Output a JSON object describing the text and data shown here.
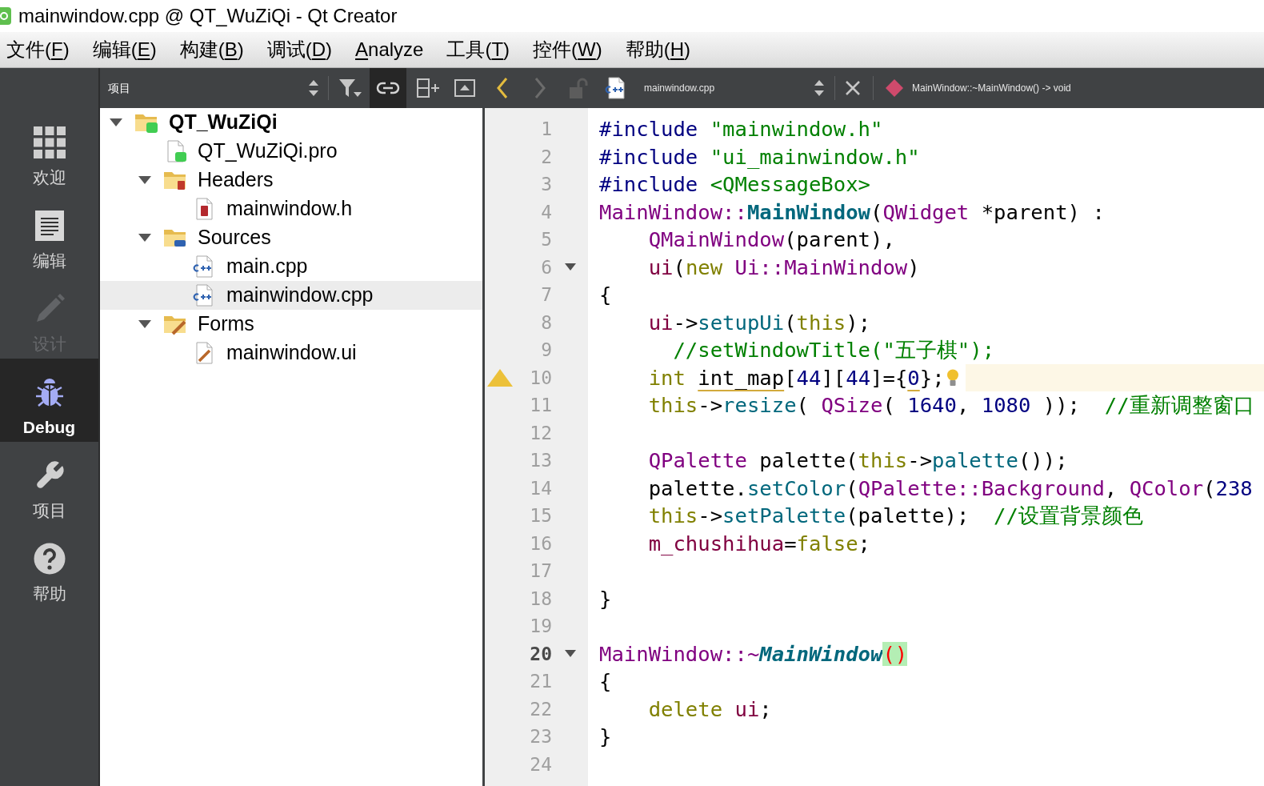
{
  "window": {
    "title": "mainwindow.cpp @ QT_WuZiQi - Qt Creator"
  },
  "menu": [
    {
      "before": "文件(",
      "key": "F",
      "after": ")"
    },
    {
      "before": "编辑(",
      "key": "E",
      "after": ")"
    },
    {
      "before": "构建(",
      "key": "B",
      "after": ")"
    },
    {
      "before": "调试(",
      "key": "D",
      "after": ")"
    },
    {
      "key": "A",
      "after": "nalyze"
    },
    {
      "before": "工具(",
      "key": "T",
      "after": ")"
    },
    {
      "before": "控件(",
      "key": "W",
      "after": ")"
    },
    {
      "before": "帮助(",
      "key": "H",
      "after": ")"
    }
  ],
  "modes": [
    {
      "label": "欢迎",
      "kind": "welcome",
      "selected": false,
      "disabled": false
    },
    {
      "label": "编辑",
      "kind": "edit",
      "selected": false,
      "disabled": false
    },
    {
      "label": "设计",
      "kind": "design",
      "selected": false,
      "disabled": true
    },
    {
      "label": "Debug",
      "kind": "debug",
      "selected": true,
      "disabled": false
    },
    {
      "label": "项目",
      "kind": "projects",
      "selected": false,
      "disabled": false
    },
    {
      "label": "帮助",
      "kind": "help",
      "selected": false,
      "disabled": false
    }
  ],
  "project_pane": {
    "view": "项目",
    "link_active": true,
    "tree": [
      {
        "label": "QT_WuZiQi",
        "kind": "project",
        "selected": false,
        "expanded": true,
        "children": [
          {
            "label": "QT_WuZiQi.pro",
            "kind": "pro",
            "selected": false
          },
          {
            "label": "Headers",
            "kind": "headers",
            "selected": false,
            "expanded": true,
            "children": [
              {
                "label": "mainwindow.h",
                "kind": "header",
                "selected": false
              }
            ]
          },
          {
            "label": "Sources",
            "kind": "sources",
            "selected": false,
            "expanded": true,
            "children": [
              {
                "label": "main.cpp",
                "kind": "source",
                "selected": false
              },
              {
                "label": "mainwindow.cpp",
                "kind": "source",
                "selected": true
              }
            ]
          },
          {
            "label": "Forms",
            "kind": "forms",
            "selected": false,
            "expanded": true,
            "children": [
              {
                "label": "mainwindow.ui",
                "kind": "form",
                "selected": false
              }
            ]
          }
        ]
      }
    ]
  },
  "editor": {
    "back_disabled": false,
    "forward_disabled": true,
    "file": "mainwindow.cpp",
    "symbol": "MainWindow::~MainWindow() -> void",
    "lines": [
      {
        "number": "1",
        "kind": "normal",
        "fold": false,
        "tokens": [
          {
            "text": "#include",
            "kind": "preprocessor"
          },
          {
            "text": " \"mainwindow.h\"",
            "kind": "string"
          }
        ]
      },
      {
        "number": "2",
        "kind": "normal",
        "fold": false,
        "tokens": [
          {
            "text": "#include",
            "kind": "preprocessor"
          },
          {
            "text": " \"ui_mainwindow.h\"",
            "kind": "string"
          }
        ]
      },
      {
        "number": "3",
        "kind": "normal",
        "fold": false,
        "tokens": [
          {
            "text": "#include",
            "kind": "preprocessor"
          },
          {
            "text": " <QMessageBox>",
            "kind": "string"
          }
        ]
      },
      {
        "number": "4",
        "kind": "normal",
        "fold": false,
        "tokens": [
          {
            "text": "MainWindow::",
            "kind": "type"
          },
          {
            "text": "MainWindow",
            "kind": "declaration"
          },
          {
            "text": "(",
            "kind": "plain"
          },
          {
            "text": "QWidget",
            "kind": "type"
          },
          {
            "text": " *parent) :",
            "kind": "plain"
          }
        ]
      },
      {
        "number": "5",
        "kind": "normal",
        "fold": false,
        "tokens": [
          {
            "text": "    QMainWindow",
            "kind": "type"
          },
          {
            "text": "(parent),",
            "kind": "plain"
          }
        ]
      },
      {
        "number": "6",
        "kind": "normal",
        "fold": true,
        "tokens": [
          {
            "text": "    ui",
            "kind": "field"
          },
          {
            "text": "(",
            "kind": "plain"
          },
          {
            "text": "new ",
            "kind": "keyword"
          },
          {
            "text": "Ui::MainWindow",
            "kind": "type"
          },
          {
            "text": ")",
            "kind": "plain"
          }
        ]
      },
      {
        "number": "7",
        "kind": "normal",
        "fold": false,
        "tokens": [
          {
            "text": "{",
            "kind": "plain"
          }
        ]
      },
      {
        "number": "8",
        "kind": "normal",
        "fold": false,
        "tokens": [
          {
            "text": "    ui",
            "kind": "field"
          },
          {
            "text": "->",
            "kind": "plain"
          },
          {
            "text": "setupUi",
            "kind": "function"
          },
          {
            "text": "(",
            "kind": "plain"
          },
          {
            "text": "this",
            "kind": "keyword"
          },
          {
            "text": ");",
            "kind": "plain"
          }
        ]
      },
      {
        "number": "9",
        "kind": "normal",
        "fold": false,
        "tokens": [
          {
            "text": "      //setWindowTitle(\"五子棋\");",
            "kind": "comment"
          }
        ]
      },
      {
        "number": "10",
        "kind": "warning",
        "fold": false,
        "tokens": [
          {
            "text": "    int ",
            "kind": "keyword"
          },
          {
            "text": "int_map",
            "kind": "warning"
          },
          {
            "text": "[",
            "kind": "plain"
          },
          {
            "text": "44",
            "kind": "number"
          },
          {
            "text": "][",
            "kind": "plain"
          },
          {
            "text": "44",
            "kind": "number"
          },
          {
            "text": "]={",
            "kind": "plain"
          },
          {
            "text": "0",
            "kind": "warning_number"
          },
          {
            "text": "};",
            "kind": "plain"
          }
        ]
      },
      {
        "number": "11",
        "kind": "normal",
        "fold": false,
        "tokens": [
          {
            "text": "    this",
            "kind": "keyword"
          },
          {
            "text": "->",
            "kind": "plain"
          },
          {
            "text": "resize",
            "kind": "function"
          },
          {
            "text": "( ",
            "kind": "plain"
          },
          {
            "text": "QSize",
            "kind": "type"
          },
          {
            "text": "( ",
            "kind": "plain"
          },
          {
            "text": "1640",
            "kind": "number"
          },
          {
            "text": ", ",
            "kind": "plain"
          },
          {
            "text": "1080",
            "kind": "number"
          },
          {
            "text": " ));  ",
            "kind": "plain"
          },
          {
            "text": "//重新调整窗口",
            "kind": "comment"
          }
        ]
      },
      {
        "number": "12",
        "kind": "normal",
        "fold": false
      },
      {
        "number": "13",
        "kind": "normal",
        "fold": false,
        "tokens": [
          {
            "text": "    QPalette",
            "kind": "type"
          },
          {
            "text": " palette(",
            "kind": "plain"
          },
          {
            "text": "this",
            "kind": "keyword"
          },
          {
            "text": "->",
            "kind": "plain"
          },
          {
            "text": "palette",
            "kind": "function"
          },
          {
            "text": "());",
            "kind": "plain"
          }
        ]
      },
      {
        "number": "14",
        "kind": "normal",
        "fold": false,
        "tokens": [
          {
            "text": "    palette.",
            "kind": "plain"
          },
          {
            "text": "setColor",
            "kind": "function"
          },
          {
            "text": "(",
            "kind": "plain"
          },
          {
            "text": "QPalette::Background",
            "kind": "type"
          },
          {
            "text": ", ",
            "kind": "plain"
          },
          {
            "text": "QColor",
            "kind": "type"
          },
          {
            "text": "(",
            "kind": "plain"
          },
          {
            "text": "238",
            "kind": "number"
          }
        ]
      },
      {
        "number": "15",
        "kind": "normal",
        "fold": false,
        "tokens": [
          {
            "text": "    this",
            "kind": "keyword"
          },
          {
            "text": "->",
            "kind": "plain"
          },
          {
            "text": "setPalette",
            "kind": "function"
          },
          {
            "text": "(palette);  ",
            "kind": "plain"
          },
          {
            "text": "//设置背景颜色",
            "kind": "comment"
          }
        ]
      },
      {
        "number": "16",
        "kind": "normal",
        "fold": false,
        "tokens": [
          {
            "text": "    m_chushihua",
            "kind": "field"
          },
          {
            "text": "=",
            "kind": "plain"
          },
          {
            "text": "false",
            "kind": "keyword"
          },
          {
            "text": ";",
            "kind": "plain"
          }
        ]
      },
      {
        "number": "17",
        "kind": "normal",
        "fold": false
      },
      {
        "number": "18",
        "kind": "normal",
        "fold": false,
        "tokens": [
          {
            "text": "}",
            "kind": "plain"
          }
        ]
      },
      {
        "number": "19",
        "kind": "normal",
        "fold": false
      },
      {
        "number": "20",
        "kind": "current",
        "fold": true,
        "tokens": [
          {
            "text": "MainWindow::~",
            "kind": "type"
          },
          {
            "text": "MainWindow",
            "kind": "virtual_declaration"
          },
          {
            "text": "()",
            "kind": "matched"
          }
        ]
      },
      {
        "number": "21",
        "kind": "normal",
        "fold": false,
        "tokens": [
          {
            "text": "{",
            "kind": "plain"
          }
        ]
      },
      {
        "number": "22",
        "kind": "normal",
        "fold": false,
        "tokens": [
          {
            "text": "    delete ",
            "kind": "keyword"
          },
          {
            "text": "ui",
            "kind": "field"
          },
          {
            "text": ";",
            "kind": "plain"
          }
        ]
      },
      {
        "number": "23",
        "kind": "normal",
        "fold": false,
        "tokens": [
          {
            "text": "}",
            "kind": "plain"
          }
        ]
      },
      {
        "number": "24",
        "kind": "normal",
        "fold": false
      }
    ]
  }
}
